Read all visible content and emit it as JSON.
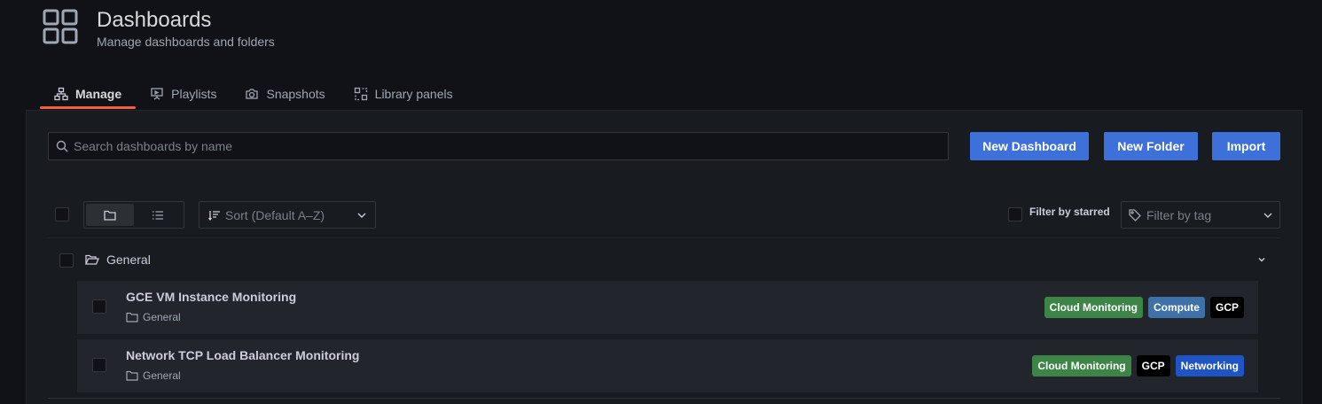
{
  "header": {
    "title": "Dashboards",
    "subtitle": "Manage dashboards and folders",
    "icon": "apps-icon"
  },
  "tabs": [
    {
      "label": "Manage",
      "icon": "sitemap-icon",
      "active": true
    },
    {
      "label": "Playlists",
      "icon": "presentation-icon",
      "active": false
    },
    {
      "label": "Snapshots",
      "icon": "camera-icon",
      "active": false
    },
    {
      "label": "Library panels",
      "icon": "library-panel-icon",
      "active": false
    }
  ],
  "search": {
    "placeholder": "Search dashboards by name",
    "value": ""
  },
  "buttons": {
    "new_dashboard": "New Dashboard",
    "new_folder": "New Folder",
    "import": "Import"
  },
  "sort": {
    "label": "Sort (Default A–Z)"
  },
  "filter_starred": {
    "label": "Filter by starred",
    "checked": false
  },
  "filter_tag": {
    "placeholder": "Filter by tag"
  },
  "folder": {
    "name": "General",
    "expanded": true
  },
  "dashboards": [
    {
      "title": "GCE VM Instance Monitoring",
      "folder": "General",
      "tags": [
        {
          "label": "Cloud Monitoring",
          "color": "#3d8547"
        },
        {
          "label": "Compute",
          "color": "#3d71a8"
        },
        {
          "label": "GCP",
          "color": "#000000"
        }
      ]
    },
    {
      "title": "Network TCP Load Balancer Monitoring",
      "folder": "General",
      "tags": [
        {
          "label": "Cloud Monitoring",
          "color": "#3d8547"
        },
        {
          "label": "GCP",
          "color": "#000000"
        },
        {
          "label": "Networking",
          "color": "#1f54c4"
        }
      ]
    }
  ],
  "colors": {
    "accent": "#3d71d9",
    "tab_underline": "#f55f3e",
    "background": "#111217",
    "panel": "#181b1f"
  }
}
